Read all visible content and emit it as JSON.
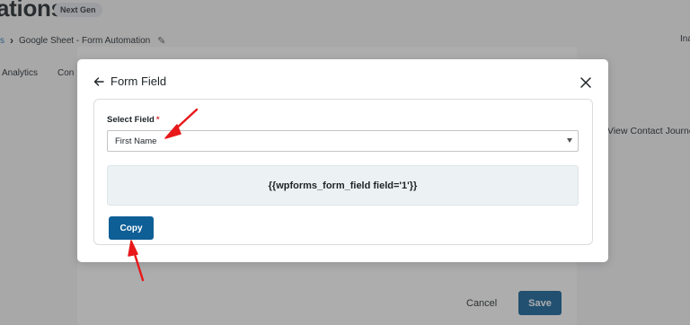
{
  "background": {
    "title": "ations",
    "badge": "Next Gen",
    "breadcrumb": {
      "prev": "s",
      "current": "Google Sheet - Form Automation"
    },
    "right_text": "Ina",
    "tabs": [
      "Analytics",
      "Con"
    ],
    "view_journey": "View Contact Journe",
    "footer": {
      "cancel_label": "Cancel",
      "save_label": "Save"
    }
  },
  "modal": {
    "title": "Form Field",
    "field_label": "Select Field",
    "required_mark": "*",
    "selected_field": "First Name",
    "shortcode": "{{wpforms_form_field field='1'}}",
    "copy_label": "Copy"
  },
  "colors": {
    "primary_button": "#0e5f96",
    "annotation_arrow": "#e8181b",
    "required": "#d63638"
  }
}
